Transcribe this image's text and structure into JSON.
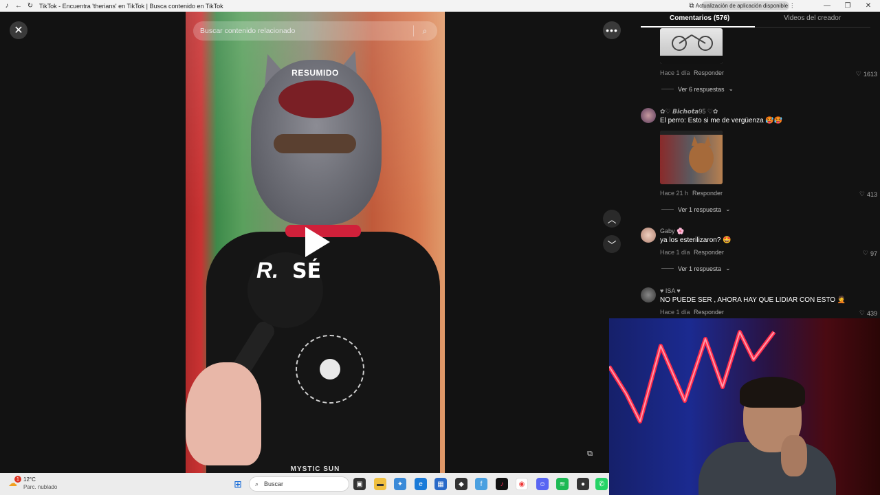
{
  "browser": {
    "title": "TikTok - Encuentra 'therians' en TikTok | Busca contenido en TikTok",
    "update_label": "Actualización de aplicación disponible"
  },
  "video": {
    "search_placeholder": "Buscar contenido relacionado",
    "overlay_title": "RESUMIDO",
    "logo_letter": "R.",
    "logo_word": "SÉ",
    "shirt_text": "MYSTIC SUN"
  },
  "panel": {
    "tabs": [
      {
        "label": "Comentarios (576)"
      },
      {
        "label": "Videos del creador"
      }
    ],
    "reply_label": "Responder",
    "comments": [
      {
        "username": "",
        "text": "",
        "time": "Hace 1 día",
        "likes": "1613",
        "view_replies": "Ver 6 respuestas"
      },
      {
        "username": "✿♡ 𝘽𝙞𝙘𝙝𝙤𝙩𝙖95 ♡✿",
        "text": "El perro: Esto si me de vergüenza 🥵🥵",
        "time": "Hace 21 h",
        "likes": "413",
        "view_replies": "Ver 1 respuesta"
      },
      {
        "username": "Gaby 🌸",
        "text": "ya los esterilizaron? 🤩",
        "time": "Hace 1 día",
        "likes": "97",
        "view_replies": "Ver 1 respuesta"
      },
      {
        "username": "♥ ISA ♥",
        "text": "NO PUEDE SER , AHORA HAY QUE LIDIAR CON ESTO 🤦",
        "time": "Hace 1 día",
        "likes": "439",
        "view_replies": ""
      }
    ]
  },
  "taskbar": {
    "weather_temp": "12°C",
    "weather_desc": "Parc. nublado",
    "weather_badge": "1",
    "search_label": "Buscar"
  },
  "colors": {
    "accent_red": "#fe2c55",
    "panel_bg": "#121212"
  }
}
